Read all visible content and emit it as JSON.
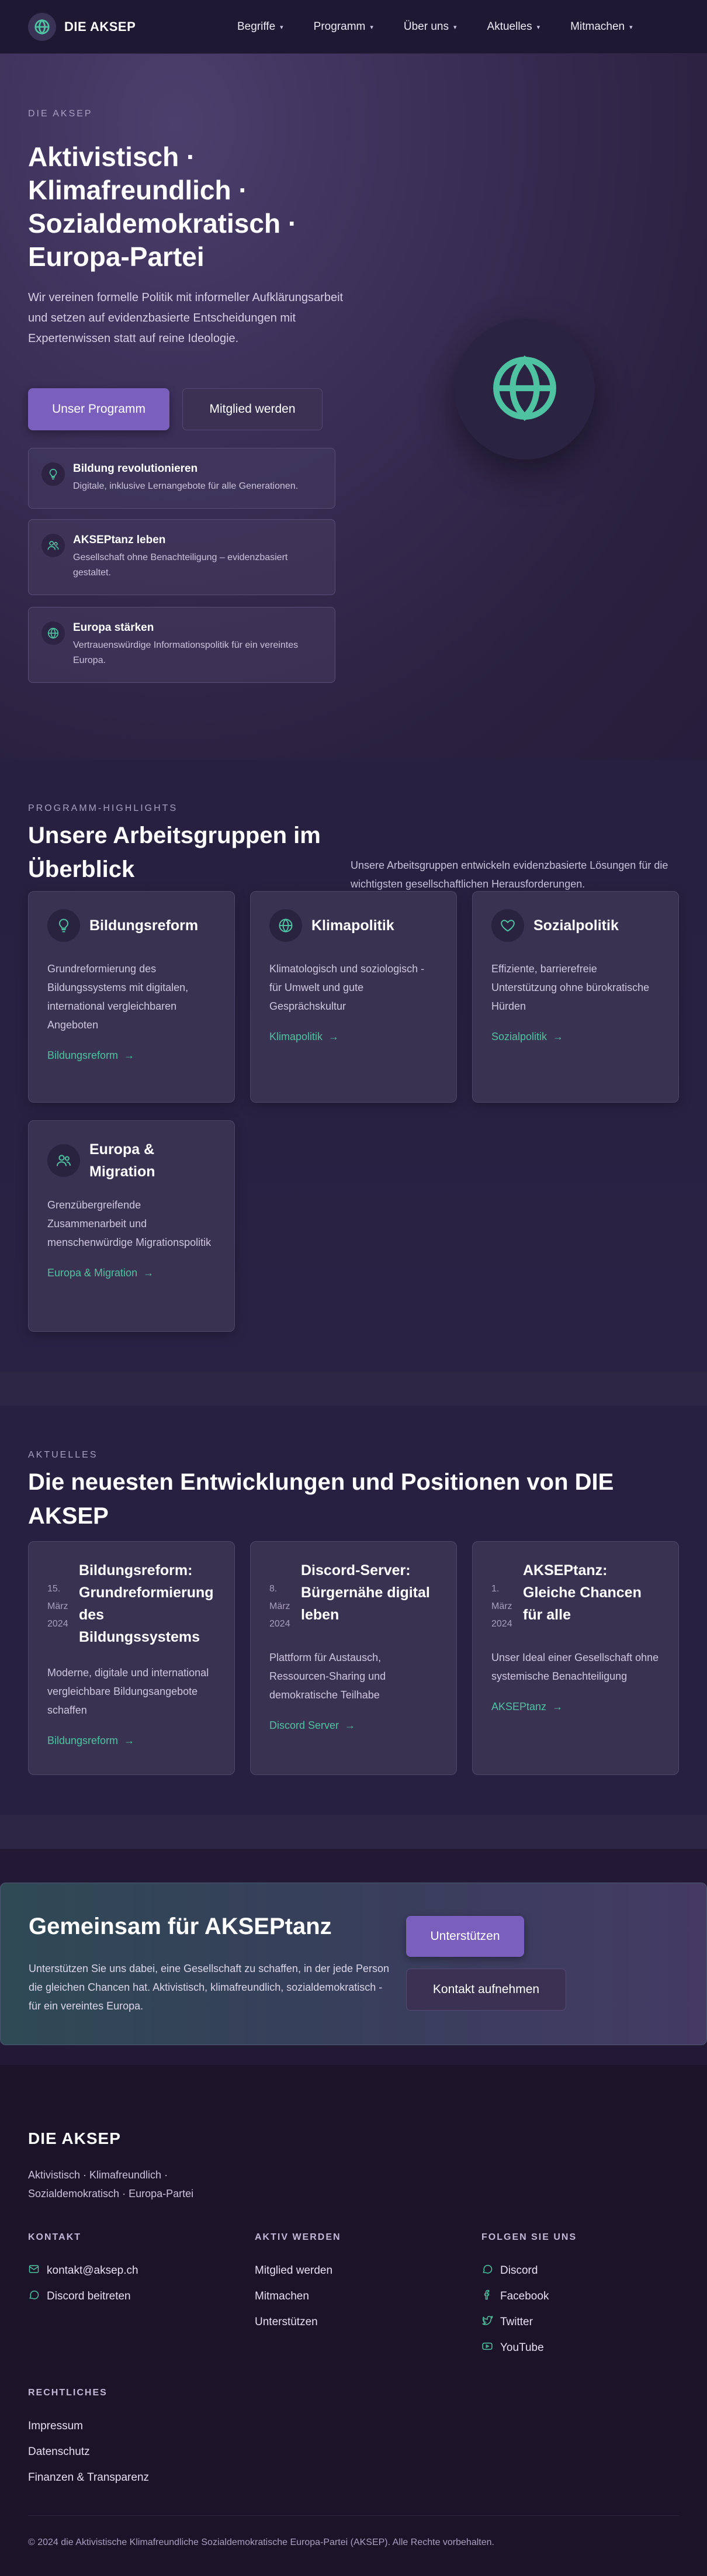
{
  "colors": {
    "accent": "#4fc3a1",
    "primary": "#7b5fbd",
    "background": "#221a35"
  },
  "nav": {
    "brand": "DIE AKSEP",
    "items": [
      {
        "label": "Begriffe"
      },
      {
        "label": "Programm"
      },
      {
        "label": "Über uns"
      },
      {
        "label": "Aktuelles"
      },
      {
        "label": "Mitmachen"
      }
    ]
  },
  "hero": {
    "eyebrow": "DIE AKSEP",
    "title": "Aktivistisch · Klimafreundlich · Sozialdemokratisch · Europa-Partei",
    "subtitle": "Wir vereinen formelle Politik mit informeller Aufklärungsarbeit und setzen auf evidenzbasierte Entscheidungen mit Expertenwissen statt auf reine Ideologie.",
    "primary_button": "Unser Programm",
    "secondary_button": "Mitglied werden",
    "features": [
      {
        "icon": "lightbulb-icon",
        "title": "Bildung revolutionieren",
        "desc": "Digitale, inklusive Lernangebote für alle Generationen."
      },
      {
        "icon": "people-icon",
        "title": "AKSEPtanz leben",
        "desc": "Gesellschaft ohne Benachteiligung – evidenzbasiert gestaltet."
      },
      {
        "icon": "globe-icon",
        "title": "Europa stärken",
        "desc": "Vertrauenswürdige Informationspolitik für ein vereintes Europa."
      }
    ]
  },
  "program": {
    "eyebrow": "PROGRAMM-HIGHLIGHTS",
    "title": "Unsere Arbeitsgruppen im Überblick",
    "intro": "Unsere Arbeitsgruppen entwickeln evidenzbasierte Lösungen für die wichtigsten gesellschaftlichen Herausforderungen.",
    "cards": [
      {
        "icon": "lightbulb-icon",
        "title": "Bildungsreform",
        "desc": "Grundreformierung des Bildungssystems mit digitalen, international vergleichbaren Angeboten",
        "link": "Bildungsreform"
      },
      {
        "icon": "globe-icon",
        "title": "Klimapolitik",
        "desc": "Klimatologisch und soziologisch - für Umwelt und gute Gesprächskultur",
        "link": "Klimapolitik"
      },
      {
        "icon": "heart-icon",
        "title": "Sozialpolitik",
        "desc": "Effiziente, barrierefreie Unterstützung ohne bürokratische Hürden",
        "link": "Sozialpolitik"
      },
      {
        "icon": "people-icon",
        "title": "Europa & Migration",
        "desc": "Grenzübergreifende Zusammenarbeit und menschenwürdige Migrationspolitik",
        "link": "Europa & Migration"
      }
    ]
  },
  "news": {
    "eyebrow": "AKTUELLES",
    "title": "Die neuesten Entwicklungen und Positionen von DIE AKSEP",
    "items": [
      {
        "day": "15.",
        "month": "März",
        "year": "2024",
        "title": "Bildungsreform: Grundreformierung des Bildungssystems",
        "desc": "Moderne, digitale und international vergleichbare Bildungsangebote schaffen",
        "link": "Bildungsreform"
      },
      {
        "day": "8.",
        "month": "März",
        "year": "2024",
        "title": "Discord-Server: Bürgernähe digital leben",
        "desc": "Plattform für Austausch, Ressourcen-Sharing und demokratische Teilhabe",
        "link": "Discord Server"
      },
      {
        "day": "1.",
        "month": "März",
        "year": "2024",
        "title": "AKSEPtanz: Gleiche Chancen für alle",
        "desc": "Unser Ideal einer Gesellschaft ohne systemische Benachteiligung",
        "link": "AKSEPtanz"
      }
    ]
  },
  "cta": {
    "title": "Gemeinsam für AKSEPtanz",
    "text": "Unterstützen Sie uns dabei, eine Gesellschaft zu schaffen, in der jede Person die gleichen Chancen hat. Aktivistisch, klimafreundlich, sozialdemokratisch - für ein vereintes Europa.",
    "primary_button": "Unterstützen",
    "secondary_button": "Kontakt aufnehmen"
  },
  "footer": {
    "brand": "DIE AKSEP",
    "tagline": "Aktivistisch · Klimafreundlich · Sozialdemokratisch · Europa-Partei",
    "contact": {
      "heading": "KONTAKT",
      "email": "kontakt@aksep.ch",
      "discord": "Discord beitreten"
    },
    "active": {
      "heading": "AKTIV WERDEN",
      "links": [
        "Mitglied werden",
        "Mitmachen",
        "Unterstützen"
      ]
    },
    "follow": {
      "heading": "FOLGEN SIE UNS",
      "links": [
        "Discord",
        "Facebook",
        "Twitter",
        "YouTube"
      ]
    },
    "legal": {
      "heading": "RECHTLICHES",
      "links": [
        "Impressum",
        "Datenschutz",
        "Finanzen & Transparenz"
      ]
    },
    "copyright": "© 2024 die Aktivistische Klimafreundliche Sozialdemokratische Europa-Partei (AKSEP). Alle Rechte vorbehalten."
  }
}
